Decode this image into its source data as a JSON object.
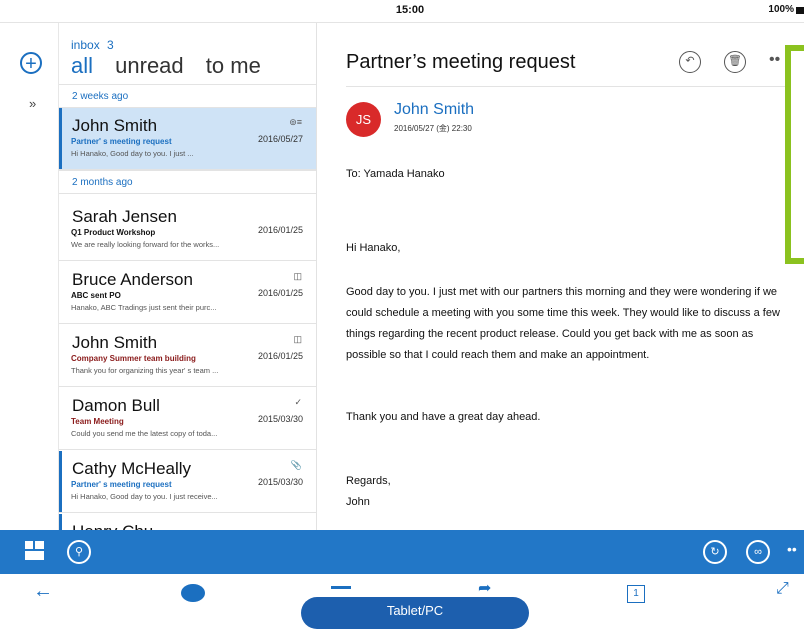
{
  "status_bar": {
    "time": "15:00",
    "battery": "100%"
  },
  "list": {
    "inbox_label": "inbox",
    "inbox_count": "3",
    "tabs": [
      "all",
      "unread",
      "to me"
    ],
    "groups": [
      "2 weeks ago",
      "2 months ago"
    ],
    "messages": [
      {
        "from": "John Smith",
        "subject": "Partner' s meeting request",
        "preview": "Hi Hanako, Good day to you. I just ...",
        "date": "2016/05/27",
        "icon": "forward-icon"
      },
      {
        "from": "Sarah Jensen",
        "subject": "Q1 Product Workshop",
        "preview": "We are really looking forward for the works...",
        "date": "2016/01/25",
        "icon": ""
      },
      {
        "from": "Bruce Anderson",
        "subject": "ABC sent PO",
        "preview": "Hanako, ABC Tradings just sent their purc...",
        "date": "2016/01/25",
        "icon": "calendar-icon"
      },
      {
        "from": "John Smith",
        "subject": "Company Summer team building",
        "preview": "Thank you for organizing this year' s team ...",
        "date": "2016/01/25",
        "icon": "calendar-icon"
      },
      {
        "from": "Damon Bull",
        "subject": "Team Meeting",
        "preview": "Could you send me the latest copy of toda...",
        "date": "2015/03/30",
        "icon": "check-icon"
      },
      {
        "from": "Cathy McHeally",
        "subject": "Partner' s meeting request",
        "preview": "Hi Hanako, Good day to you. I just receive...",
        "date": "2015/03/30",
        "icon": "paperclip-icon"
      },
      {
        "from": "Henry Chu",
        "subject": "",
        "preview": "",
        "date": "",
        "icon": ""
      }
    ]
  },
  "reading": {
    "subject": "Partner’s meeting request",
    "avatar_initials": "JS",
    "sender": "John Smith",
    "sent": "2016/05/27 (金) 22:30",
    "to_line": "To:  Yamada Hanako",
    "greeting": "Hi Hanako,",
    "body": "Good day to you. I just met with our partners this morning and they were wondering if we could schedule a meeting with you some time this week. They would like to discuss a few things regarding the recent product release. Could you get back with me as soon as possible so that I could reach them and make an appointment.",
    "thanks": "Thank you and have a great day ahead.",
    "regards": "Regards,",
    "signature": "John"
  },
  "overlay": {
    "pill_label": "Tablet/PC"
  },
  "colors": {
    "accent": "#1b6fc0",
    "app_bar": "#2277c7",
    "selected_row": "#cfe3f6",
    "avatar": "#d92a2a",
    "callout": "#8bc21f"
  }
}
